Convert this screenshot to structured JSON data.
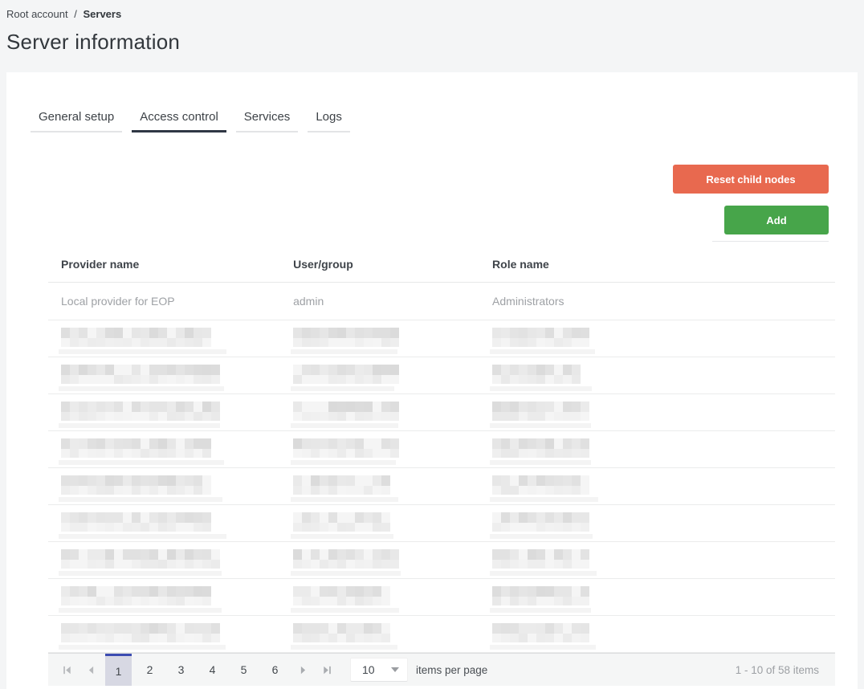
{
  "breadcrumb": {
    "root": "Root account",
    "separator": "/",
    "current": "Servers"
  },
  "page_title": "Server information",
  "tabs": [
    {
      "label": "General setup",
      "active": false
    },
    {
      "label": "Access control",
      "active": true
    },
    {
      "label": "Services",
      "active": false
    },
    {
      "label": "Logs",
      "active": false
    }
  ],
  "toolbar": {
    "reset_button": "Reset child nodes",
    "add_button": "Add"
  },
  "table": {
    "columns": [
      "Provider name",
      "User/group",
      "Role name"
    ],
    "rows": [
      {
        "provider": "Local provider for EOP",
        "user_group": "admin",
        "role": "Administrators"
      }
    ],
    "redacted_row_count": 9
  },
  "pager": {
    "pages": [
      "1",
      "2",
      "3",
      "4",
      "5",
      "6"
    ],
    "current_page": "1",
    "page_size": "10",
    "items_per_page_label": "items per page",
    "range_label": "1 - 10 of 58 items"
  },
  "colors": {
    "reset_button": "#e8694f",
    "add_button": "#47a54a",
    "active_tab_underline": "#2f3744",
    "pager_selected_bg": "#d7d8e3",
    "pager_selected_border": "#3c4cb1"
  }
}
